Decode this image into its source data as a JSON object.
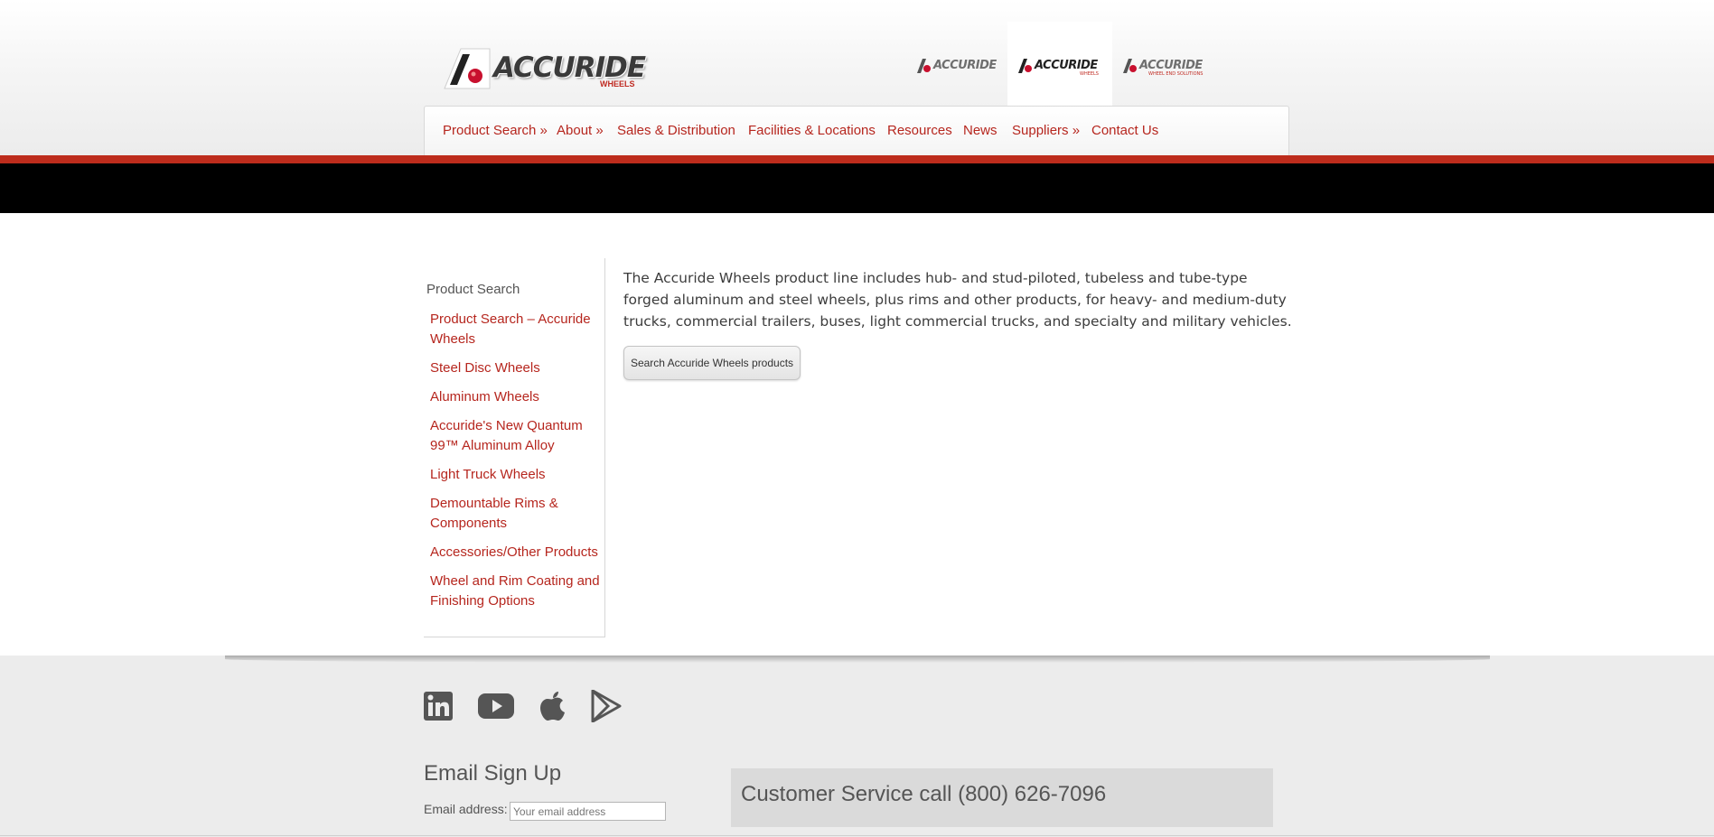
{
  "header": {
    "logo": {
      "wordmark": "ACCURIDE",
      "sub": "WHEELS"
    },
    "brands": [
      {
        "wordmark": "ACCURIDE",
        "sub": "",
        "active": false
      },
      {
        "wordmark": "ACCURIDE",
        "sub": "WHEELS",
        "active": true
      },
      {
        "wordmark": "ACCURIDE",
        "sub": "WHEEL END SOLUTIONS",
        "active": false
      }
    ],
    "accent_color": "#bd2c1c",
    "link_color": "#b6261e"
  },
  "nav": {
    "items": [
      {
        "label": "Product Search »"
      },
      {
        "label": "About »"
      },
      {
        "label": "Sales & Distribution"
      },
      {
        "label": "Facilities & Locations"
      },
      {
        "label": "Resources"
      },
      {
        "label": "News"
      },
      {
        "label": "Suppliers »"
      },
      {
        "label": "Contact Us"
      }
    ]
  },
  "sidebar": {
    "title": "Product Search",
    "links": [
      {
        "label": "Product Search – Accuride Wheels"
      },
      {
        "label": "Steel Disc Wheels"
      },
      {
        "label": "Aluminum Wheels"
      },
      {
        "label": "Accuride's New Quantum 99™ Aluminum Alloy"
      },
      {
        "label": "Light Truck Wheels"
      },
      {
        "label": "Demountable Rims & Components"
      },
      {
        "label": "Accessories/Other Products"
      },
      {
        "label": "Wheel and Rim Coating and Finishing Options"
      }
    ]
  },
  "main": {
    "intro": "The Accuride Wheels product line includes hub- and stud-piloted, tubeless and tube-type forged aluminum and steel wheels, plus rims and other products, for heavy- and medium-duty trucks, commercial trailers, buses, light commercial trucks, and specialty and military vehicles.",
    "search_button": "Search Accuride Wheels products"
  },
  "footer": {
    "social_icons": [
      "linkedin-icon",
      "youtube-icon",
      "apple-icon",
      "google-play-icon"
    ],
    "email_title": "Email Sign Up",
    "email_label": "Email address:",
    "email_placeholder": "Your email address",
    "customer_service": "Customer Service call (800) 626-7096"
  }
}
